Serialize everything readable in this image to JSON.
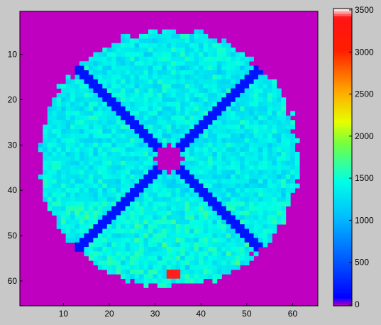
{
  "chart_data": {
    "type": "heatmap",
    "title": "",
    "xlabel": "",
    "ylabel": "",
    "grid": false,
    "xlim": [
      0.5,
      65.5
    ],
    "ylim": [
      0.5,
      65.5
    ],
    "y_direction": "top-down",
    "x_ticks": [
      10,
      20,
      30,
      40,
      50,
      60
    ],
    "y_ticks": [
      10,
      20,
      30,
      40,
      50,
      60
    ],
    "image_size": [
      65,
      65
    ],
    "colormap": "hsv-like (magenta at 0, blue, cyan, green, yellow, orange, red, white at max)",
    "colorbar": {
      "placement": "right",
      "range": [
        0,
        3500
      ],
      "ticks": [
        0,
        500,
        1000,
        1500,
        2000,
        2500,
        3000,
        3500
      ]
    },
    "background_value": 0,
    "mask": {
      "disc_center": [
        33,
        33
      ],
      "disc_radius": 28,
      "center_hole_radius": 3,
      "cross_bars": "two diagonal gaps forming an X through the center"
    },
    "typical_values": {
      "inside_disc_range": [
        700,
        1600
      ],
      "gap_lines": 200,
      "hot_spot": {
        "x": [
          33,
          35
        ],
        "y": [
          58,
          59
        ],
        "value": 3400
      }
    },
    "colors": {
      "background_panel": "#c8c8c8",
      "zero_value": "#c000c0"
    }
  }
}
